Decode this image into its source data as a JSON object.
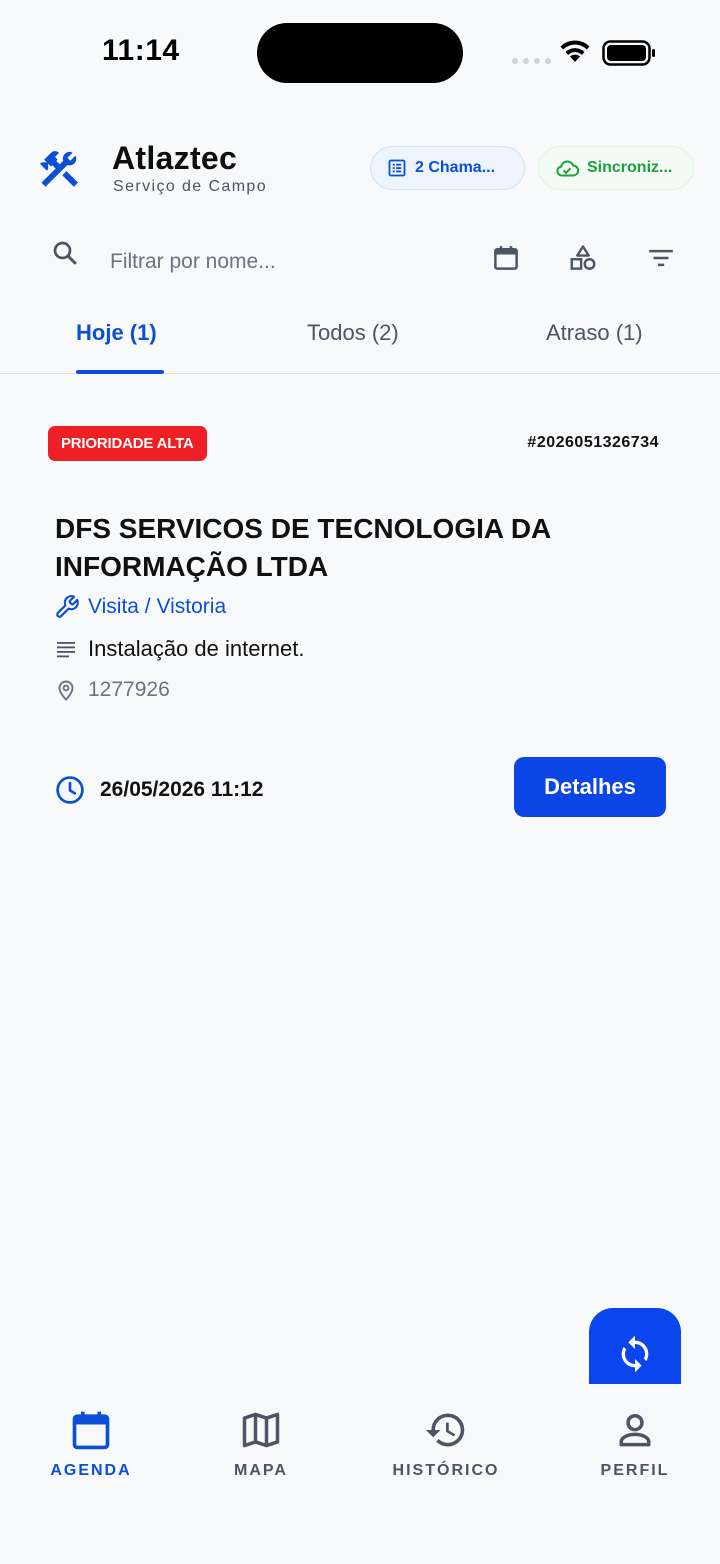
{
  "status_bar": {
    "time": "11:14"
  },
  "header": {
    "title": "Atlaztec",
    "subtitle": "Serviço de Campo",
    "calls_chip": "2 Chama...",
    "sync_chip": "Sincroniz..."
  },
  "search": {
    "placeholder": "Filtrar por nome..."
  },
  "tabs": [
    {
      "label": "Hoje (1)",
      "active": true
    },
    {
      "label": "Todos (2)",
      "active": false
    },
    {
      "label": "Atraso (1)",
      "active": false
    }
  ],
  "card": {
    "priority": "PRIORIDADE ALTA",
    "order_number": "#2026051326734",
    "client_name": "DFS SERVICOS DE TECNOLOGIA DA INFORMAÇÃO LTDA",
    "service_type": "Visita / Vistoria",
    "description": "Instalação de internet.",
    "code": "1277926",
    "datetime": "26/05/2026 11:12",
    "details_label": "Detalhes"
  },
  "bottom_nav": [
    {
      "label": "AGENDA",
      "icon": "calendar-icon",
      "active": true
    },
    {
      "label": "MAPA",
      "icon": "map-icon",
      "active": false
    },
    {
      "label": "HISTÓRICO",
      "icon": "history-icon",
      "active": false
    },
    {
      "label": "PERFIL",
      "icon": "person-icon",
      "active": false
    }
  ],
  "colors": {
    "primary": "#0b4fd6",
    "priority_red": "#ee1f25",
    "sync_green": "#1aa33a",
    "background": "#f8f9fb"
  }
}
